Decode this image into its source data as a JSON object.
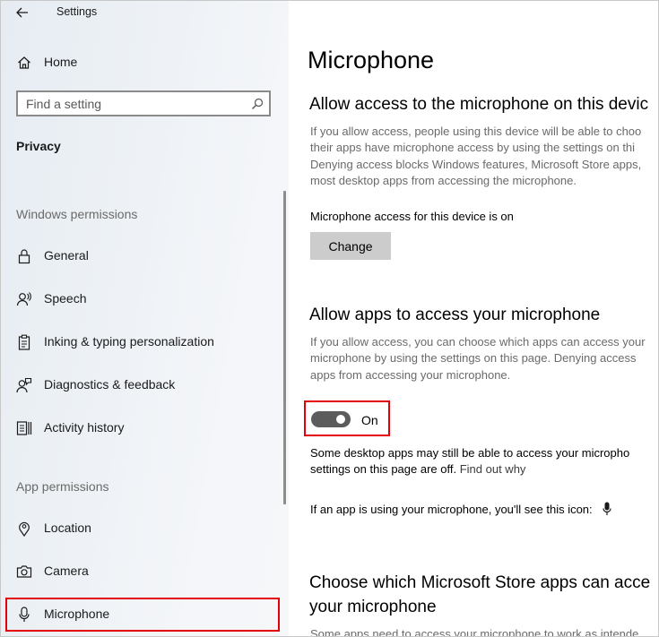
{
  "window": {
    "title": "Settings"
  },
  "sidebar": {
    "home_label": "Home",
    "search_placeholder": "Find a setting",
    "section_title": "Privacy",
    "groups": {
      "windows_permissions": "Windows permissions",
      "app_permissions": "App permissions"
    },
    "items": [
      {
        "label": "General",
        "icon": "lock-icon"
      },
      {
        "label": "Speech",
        "icon": "speech-icon"
      },
      {
        "label": "Inking & typing personalization",
        "icon": "clipboard-icon"
      },
      {
        "label": "Diagnostics & feedback",
        "icon": "person-feedback-icon"
      },
      {
        "label": "Activity history",
        "icon": "activity-history-icon"
      },
      {
        "label": "Location",
        "icon": "location-icon"
      },
      {
        "label": "Camera",
        "icon": "camera-icon"
      },
      {
        "label": "Microphone",
        "icon": "microphone-icon",
        "selected": true
      }
    ]
  },
  "content": {
    "page_title": "Microphone",
    "device_section": {
      "heading": "Allow access to the microphone on this devic",
      "description_lines": [
        "If you allow access, people using this device will be able to choo",
        "their apps have microphone access by using the settings on thi",
        "Denying access blocks Windows features, Microsoft Store apps,",
        "most desktop apps from accessing the microphone."
      ],
      "status_text": "Microphone access for this device is on",
      "change_button": "Change"
    },
    "apps_section": {
      "heading": "Allow apps to access your microphone",
      "description_lines": [
        "If you allow access, you can choose which apps can access your",
        "microphone by using the settings on this page. Denying access",
        "apps from accessing your microphone."
      ],
      "toggle_state": "On",
      "toggle_on": true,
      "note_line1": "Some desktop apps may still be able to access your micropho",
      "note_line2_prefix": "settings on this page are off.",
      "note_link": "Find out why",
      "icon_note": "If an app is using your microphone, you'll see this icon:"
    },
    "store_section": {
      "heading_line1": "Choose which Microsoft Store apps can acce",
      "heading_line2": "your microphone",
      "description_partial": "Some apps need to access your microphone to work as intende"
    }
  },
  "colors": {
    "highlight_red": "#e3000b",
    "toggle_on": "#5c5c5c",
    "button_gray": "#cccccc",
    "secondary_text": "#6a6a6a"
  }
}
